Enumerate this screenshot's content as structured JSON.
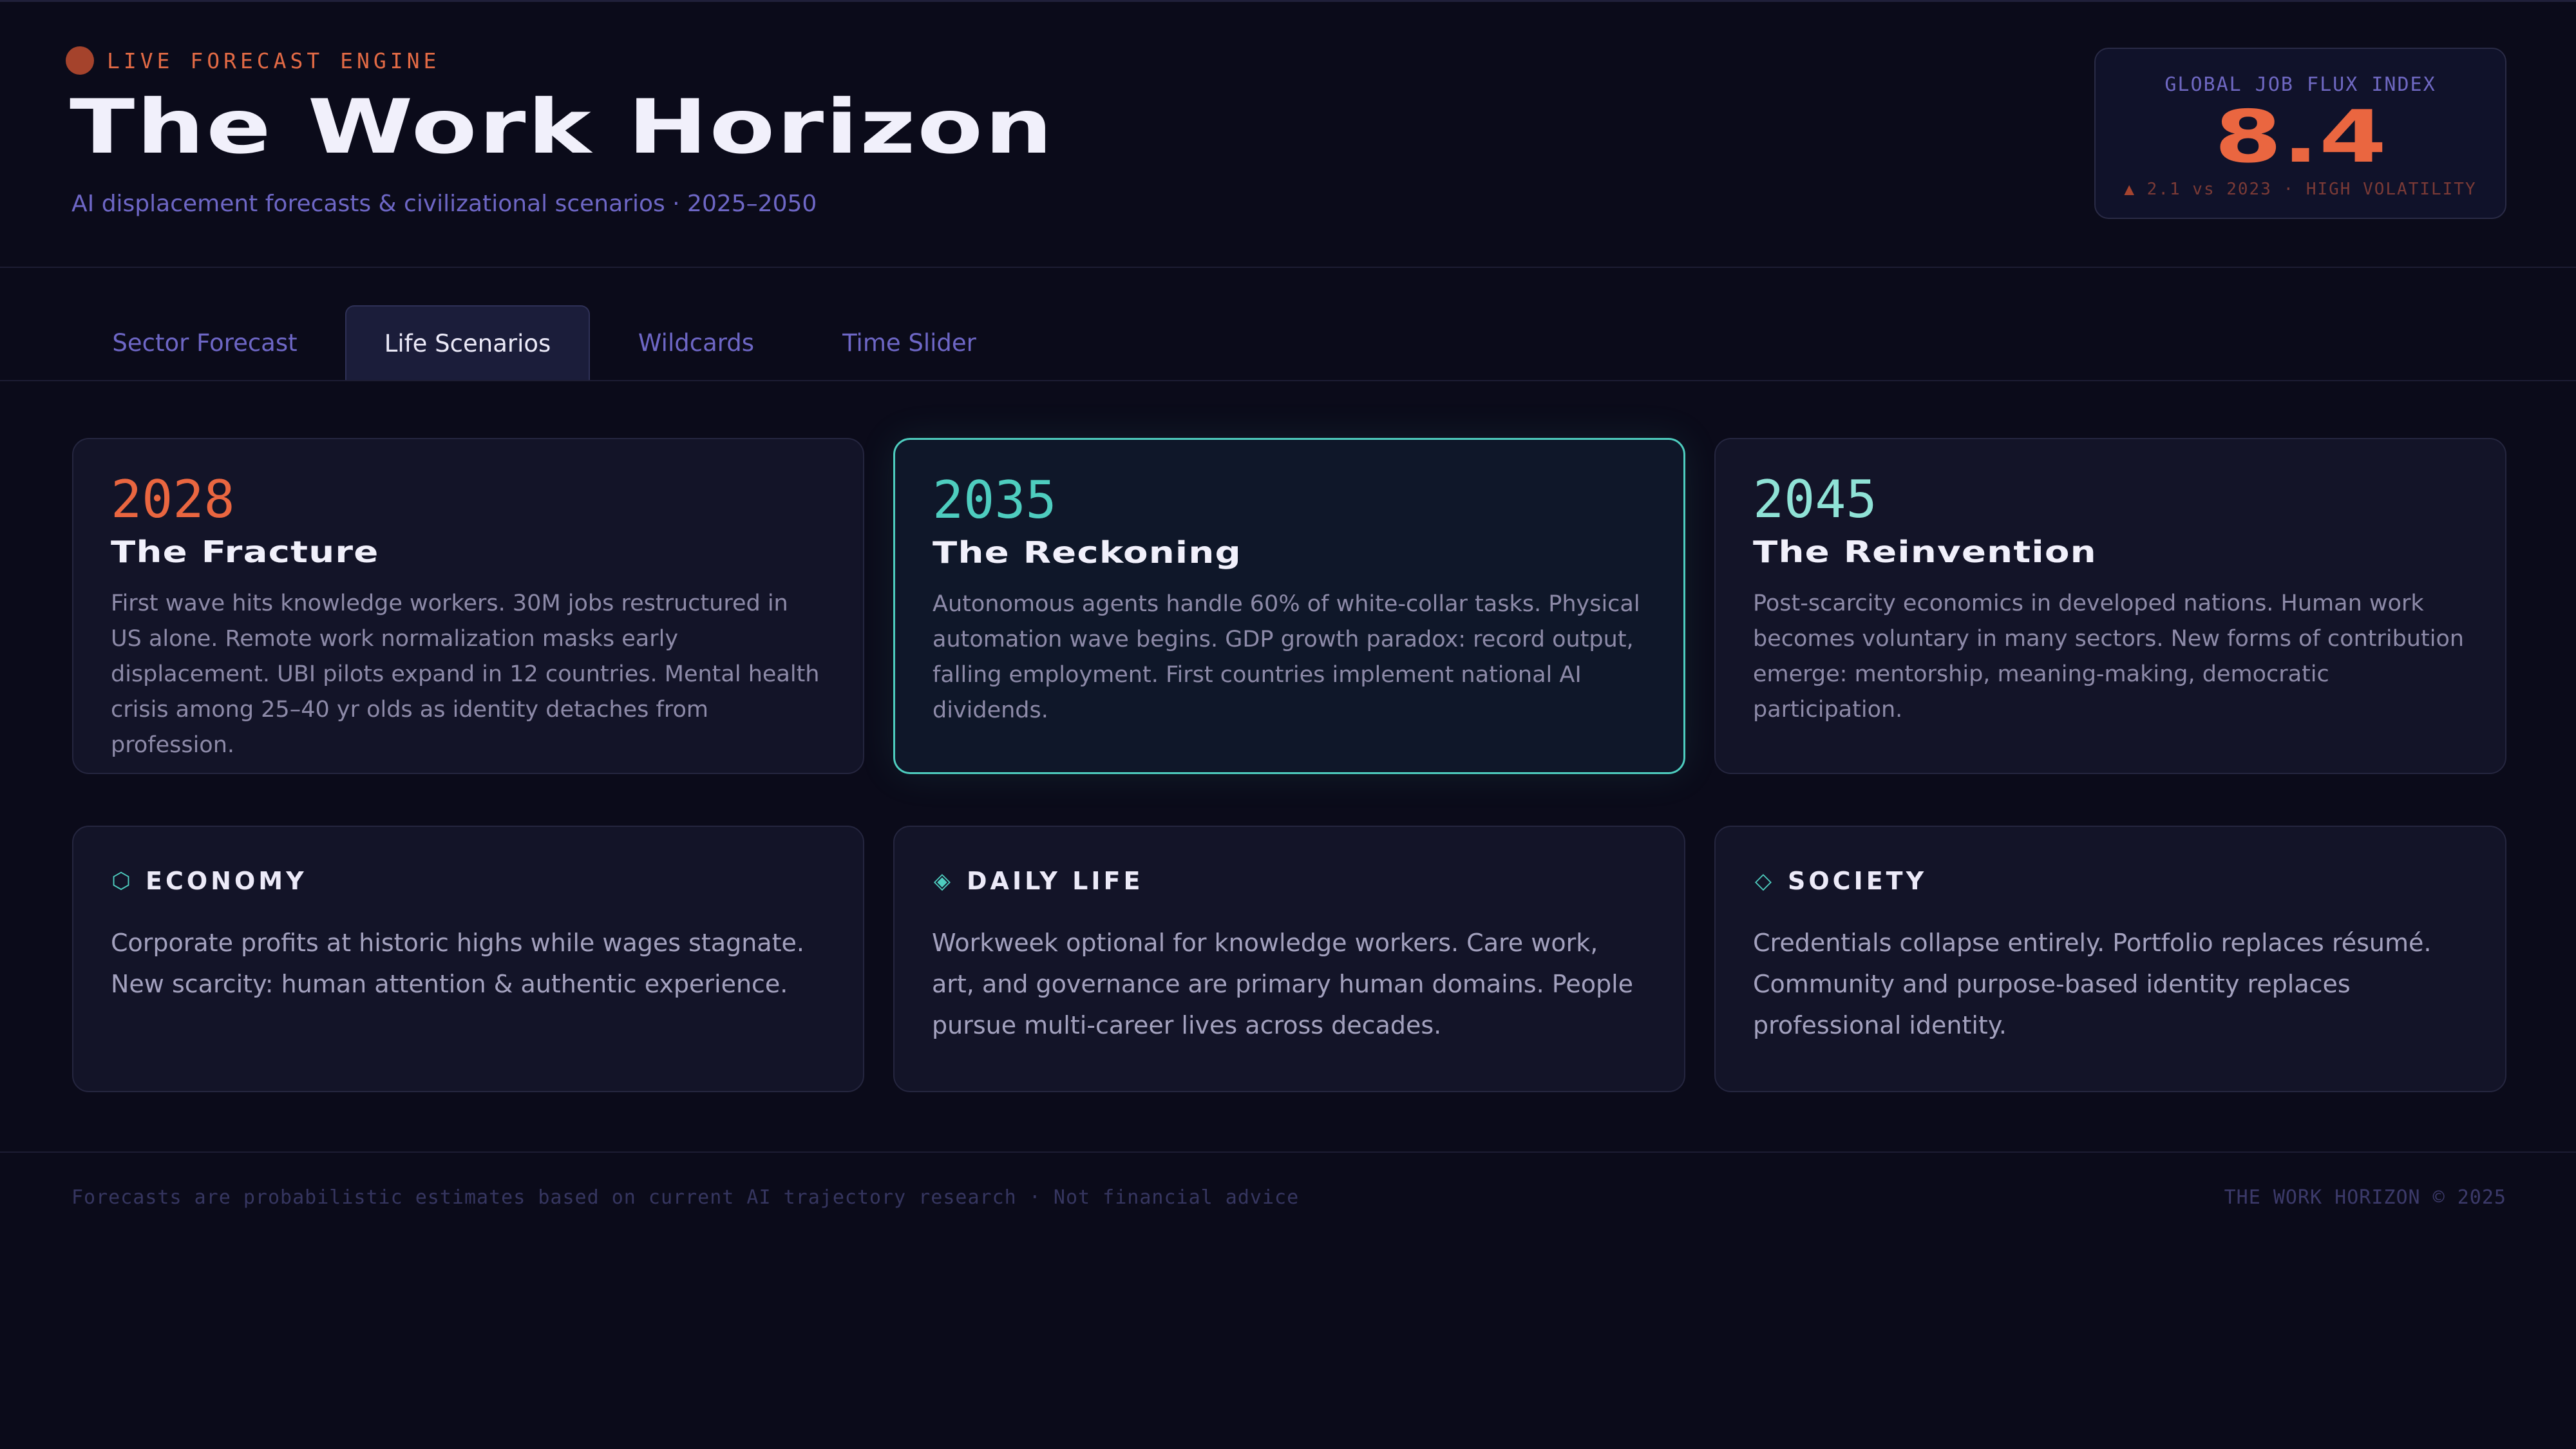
{
  "header": {
    "live_label": "LIVE FORECAST ENGINE",
    "title": "The Work Horizon",
    "subtitle": "AI displacement forecasts & civilizational scenarios · 2025–2050"
  },
  "index": {
    "label": "GLOBAL JOB FLUX INDEX",
    "value": "8.4",
    "delta_arrow": "▲",
    "delta_text": "2.1 vs 2023 · HIGH VOLATILITY"
  },
  "tabs": [
    {
      "label": "Sector Forecast"
    },
    {
      "label": "Life Scenarios"
    },
    {
      "label": "Wildcards"
    },
    {
      "label": "Time Slider"
    }
  ],
  "active_tab": "Life Scenarios",
  "scenarios": [
    {
      "year": "2028",
      "title": "The Fracture",
      "description": "First wave hits knowledge workers. 30M jobs restructured in US alone. Remote work normalization masks early displacement. UBI pilots expand in 12 countries. Mental health crisis among 25–40 yr olds as identity detaches from profession."
    },
    {
      "year": "2035",
      "title": "The Reckoning",
      "description": "Autonomous agents handle 60% of white-collar tasks. Physical automation wave begins. GDP growth paradox: record output, falling employment. First countries implement national AI dividends."
    },
    {
      "year": "2045",
      "title": "The Reinvention",
      "description": "Post-scarcity economics in developed nations. Human work becomes voluntary in many sectors. New forms of contribution emerge: mentorship, meaning-making, democratic participation."
    }
  ],
  "topics": [
    {
      "icon": "⬡",
      "icon_name": "hexagon-icon",
      "name": "ECONOMY",
      "description": "Corporate profits at historic highs while wages stagnate. New scarcity: human attention & authentic experience."
    },
    {
      "icon": "◈",
      "icon_name": "diamond-filled-icon",
      "name": "DAILY LIFE",
      "description": "Workweek optional for knowledge workers. Care work, art, and governance are primary human domains. People pursue multi-career lives across decades."
    },
    {
      "icon": "◇",
      "icon_name": "diamond-outline-icon",
      "name": "SOCIETY",
      "description": "Credentials collapse entirely. Portfolio replaces résumé. Community and purpose-based identity replaces professional identity."
    }
  ],
  "footer": {
    "disclaimer": "Forecasts are probabilistic estimates based on current AI trajectory research · Not financial advice",
    "copyright": "THE WORK HORIZON © 2025"
  },
  "colors": {
    "background": "#0b0b1a",
    "accent_orange": "#ea6640",
    "accent_teal": "#4ecdbf",
    "muted_purple": "#6e67c6"
  }
}
